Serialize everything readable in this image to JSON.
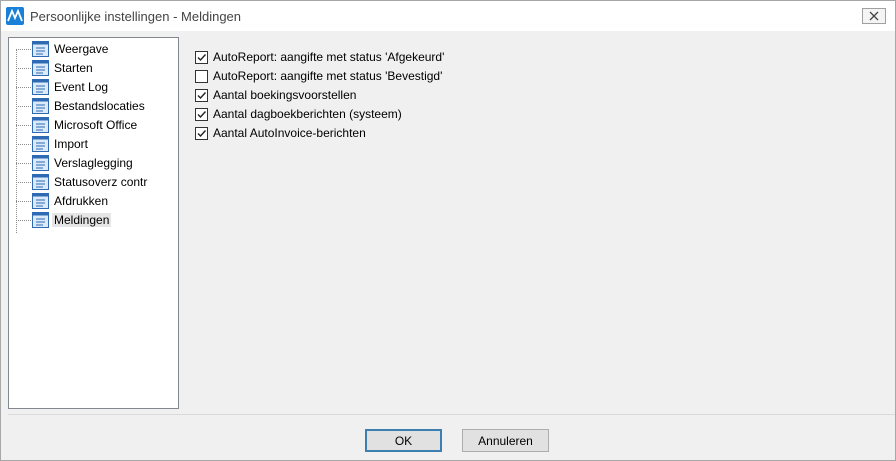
{
  "window": {
    "title": "Persoonlijke instellingen - Meldingen"
  },
  "tree": {
    "items": [
      {
        "label": "Weergave",
        "selected": false
      },
      {
        "label": "Starten",
        "selected": false
      },
      {
        "label": "Event Log",
        "selected": false
      },
      {
        "label": "Bestandslocaties",
        "selected": false
      },
      {
        "label": "Microsoft Office",
        "selected": false
      },
      {
        "label": "Import",
        "selected": false
      },
      {
        "label": "Verslaglegging",
        "selected": false
      },
      {
        "label": "Statusoverz contr",
        "selected": false
      },
      {
        "label": "Afdrukken",
        "selected": false
      },
      {
        "label": "Meldingen",
        "selected": true
      }
    ]
  },
  "options": [
    {
      "label": "AutoReport: aangifte met status 'Afgekeurd'",
      "checked": true
    },
    {
      "label": "AutoReport: aangifte met status 'Bevestigd'",
      "checked": false
    },
    {
      "label": "Aantal boekingsvoorstellen",
      "checked": true
    },
    {
      "label": "Aantal dagboekberichten (systeem)",
      "checked": true
    },
    {
      "label": "Aantal AutoInvoice-berichten",
      "checked": true
    }
  ],
  "buttons": {
    "ok_label": "OK",
    "cancel_label": "Annuleren"
  },
  "colors": {
    "app_icon": "#1a7fd6",
    "node_icon_border": "#2e6ab3",
    "node_icon_fill": "#dbe9f8"
  }
}
